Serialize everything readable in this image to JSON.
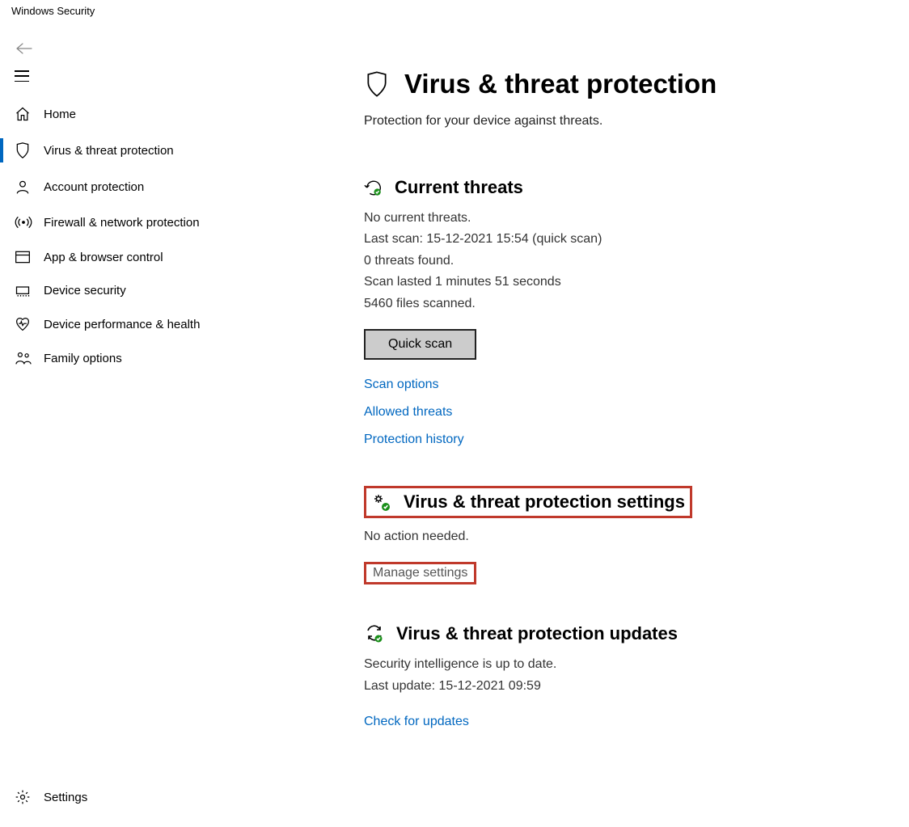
{
  "window_title": "Windows Security",
  "sidebar": {
    "items": [
      {
        "label": "Home"
      },
      {
        "label": "Virus & threat protection"
      },
      {
        "label": "Account protection"
      },
      {
        "label": "Firewall & network protection"
      },
      {
        "label": "App & browser control"
      },
      {
        "label": "Device security"
      },
      {
        "label": "Device performance & health"
      },
      {
        "label": "Family options"
      }
    ],
    "settings_label": "Settings"
  },
  "page": {
    "title": "Virus & threat protection",
    "subtitle": "Protection for your device against threats."
  },
  "current_threats": {
    "heading": "Current threats",
    "status": "No current threats.",
    "last_scan": "Last scan: 15-12-2021 15:54 (quick scan)",
    "threats_found": "0 threats found.",
    "duration": "Scan lasted 1 minutes 51 seconds",
    "files_scanned": "5460 files scanned.",
    "quick_scan_btn": "Quick scan",
    "links": {
      "scan_options": "Scan options",
      "allowed_threats": "Allowed threats",
      "protection_history": "Protection history"
    }
  },
  "settings_section": {
    "heading": "Virus & threat protection settings",
    "status": "No action needed.",
    "manage_link": "Manage settings"
  },
  "updates_section": {
    "heading": "Virus & threat protection updates",
    "status": "Security intelligence is up to date.",
    "last_update": "Last update: 15-12-2021 09:59",
    "check_link": "Check for updates"
  }
}
